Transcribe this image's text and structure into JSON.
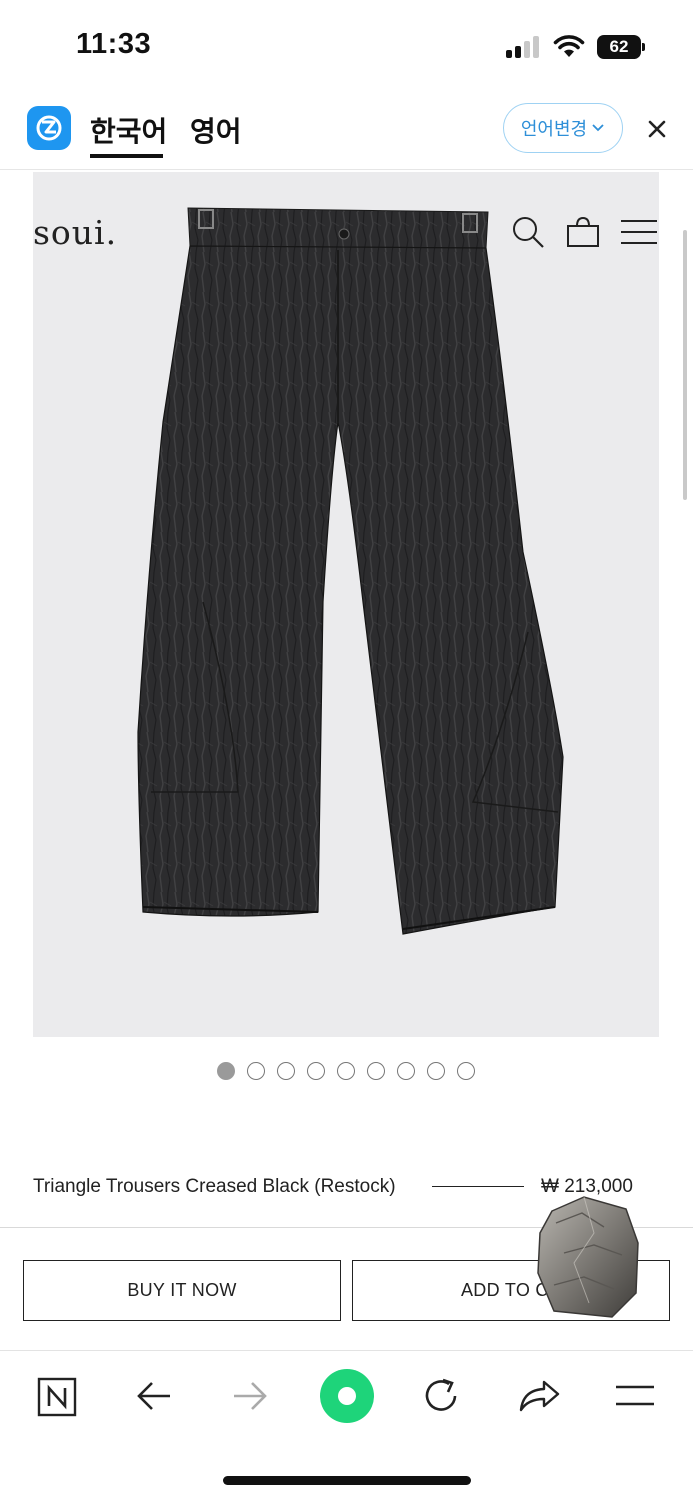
{
  "status_bar": {
    "time": "11:33",
    "battery": "62"
  },
  "translator": {
    "tab_source": "한국어",
    "tab_target": "영어",
    "change_language": "언어변경"
  },
  "site": {
    "brand": "soui",
    "brand_dot": "."
  },
  "product": {
    "name": "Triangle Trousers Creased Black (Restock)",
    "price": "₩ 213,000",
    "image_count": 9,
    "active_image": 1
  },
  "actions": {
    "buy_now": "BUY IT NOW",
    "add_to_cart": "ADD TO CA"
  },
  "colors": {
    "accent_blue": "#1e96f0",
    "browser_green": "#1ed47a",
    "image_bg": "#ebebed"
  },
  "toolbar_icons": [
    "naver-n-icon",
    "back-arrow-icon",
    "forward-arrow-icon",
    "green-dot-icon",
    "reload-icon",
    "share-icon",
    "menu-icon"
  ]
}
